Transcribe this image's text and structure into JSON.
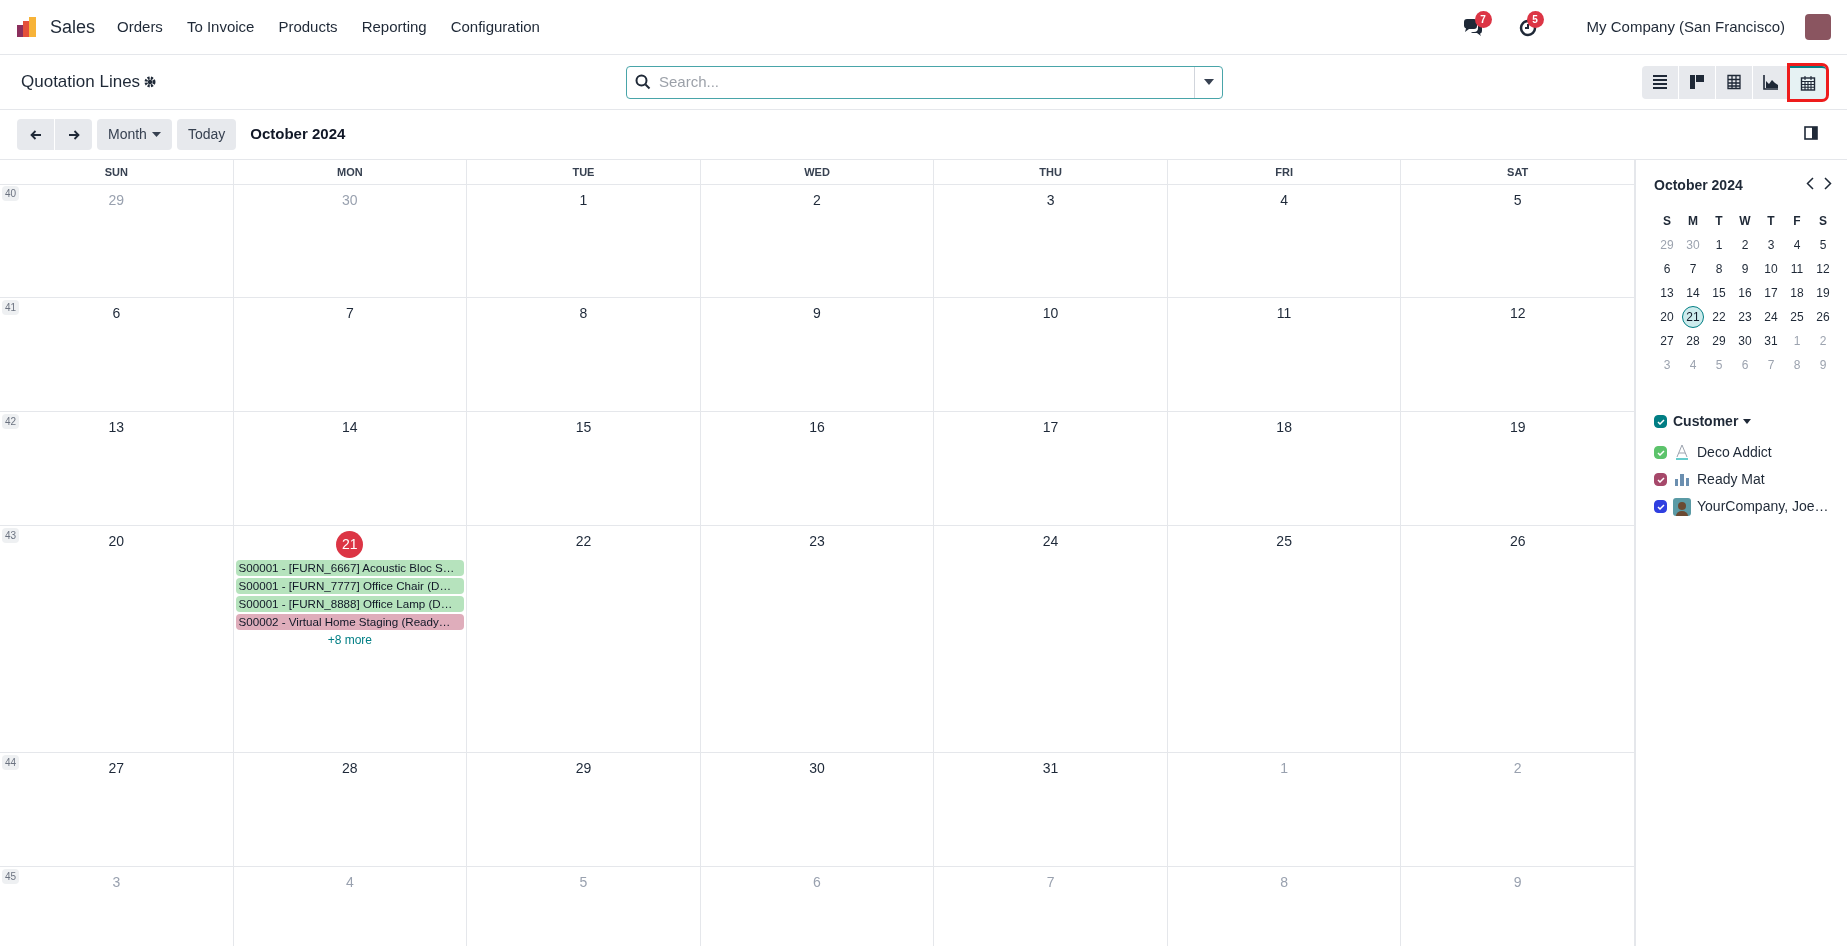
{
  "navbar": {
    "app": "Sales",
    "menus": [
      "Orders",
      "To Invoice",
      "Products",
      "Reporting",
      "Configuration"
    ],
    "messages_count": "7",
    "activities_count": "5",
    "company": "My Company (San Francisco)"
  },
  "control_panel": {
    "title": "Quotation Lines",
    "search": {
      "placeholder": "Search..."
    },
    "views": [
      {
        "kind": "list",
        "selected": false
      },
      {
        "kind": "kanban",
        "selected": false
      },
      {
        "kind": "pivot",
        "selected": false
      },
      {
        "kind": "graph",
        "selected": false
      },
      {
        "kind": "calendar",
        "selected": true
      }
    ]
  },
  "toolbar": {
    "scale": "Month",
    "today": "Today",
    "period": "October 2024"
  },
  "calendar": {
    "weekdays": [
      "SUN",
      "MON",
      "TUE",
      "WED",
      "THU",
      "FRI",
      "SAT"
    ],
    "weeks": [
      {
        "number": "40",
        "days": [
          {
            "label": "29",
            "muted": true
          },
          {
            "label": "30",
            "muted": true
          },
          {
            "label": "1",
            "muted": false
          },
          {
            "label": "2",
            "muted": false
          },
          {
            "label": "3",
            "muted": false
          },
          {
            "label": "4",
            "muted": false
          },
          {
            "label": "5",
            "muted": false
          }
        ]
      },
      {
        "number": "41",
        "days": [
          {
            "label": "6",
            "muted": false
          },
          {
            "label": "7",
            "muted": false
          },
          {
            "label": "8",
            "muted": false
          },
          {
            "label": "9",
            "muted": false
          },
          {
            "label": "10",
            "muted": false
          },
          {
            "label": "11",
            "muted": false
          },
          {
            "label": "12",
            "muted": false
          }
        ]
      },
      {
        "number": "42",
        "days": [
          {
            "label": "13",
            "muted": false
          },
          {
            "label": "14",
            "muted": false
          },
          {
            "label": "15",
            "muted": false
          },
          {
            "label": "16",
            "muted": false
          },
          {
            "label": "17",
            "muted": false
          },
          {
            "label": "18",
            "muted": false
          },
          {
            "label": "19",
            "muted": false
          }
        ]
      },
      {
        "number": "43",
        "days": [
          {
            "label": "20",
            "muted": false
          },
          {
            "label": "21",
            "muted": false,
            "today": true,
            "events": [
              {
                "title": "S00001 - [FURN_6667] Acoustic Bloc S…",
                "color": "#b6e3bd"
              },
              {
                "title": "S00001 - [FURN_7777] Office Chair (D…",
                "color": "#b6e3bd"
              },
              {
                "title": "S00001 - [FURN_8888] Office Lamp (D…",
                "color": "#b6e3bd"
              },
              {
                "title": "S00002 - Virtual Home Staging (Ready…",
                "color": "#dfadbb"
              }
            ],
            "more": "+8 more"
          },
          {
            "label": "22",
            "muted": false
          },
          {
            "label": "23",
            "muted": false
          },
          {
            "label": "24",
            "muted": false
          },
          {
            "label": "25",
            "muted": false
          },
          {
            "label": "26",
            "muted": false
          }
        ]
      },
      {
        "number": "44",
        "days": [
          {
            "label": "27",
            "muted": false
          },
          {
            "label": "28",
            "muted": false
          },
          {
            "label": "29",
            "muted": false
          },
          {
            "label": "30",
            "muted": false
          },
          {
            "label": "31",
            "muted": false
          },
          {
            "label": "1",
            "muted": true
          },
          {
            "label": "2",
            "muted": true
          }
        ]
      },
      {
        "number": "45",
        "days": [
          {
            "label": "3",
            "muted": true
          },
          {
            "label": "4",
            "muted": true
          },
          {
            "label": "5",
            "muted": true
          },
          {
            "label": "6",
            "muted": true
          },
          {
            "label": "7",
            "muted": true
          },
          {
            "label": "8",
            "muted": true
          },
          {
            "label": "9",
            "muted": true
          }
        ]
      }
    ]
  },
  "sidebar": {
    "mini_calendar": {
      "title": "October 2024",
      "weekdays": [
        "S",
        "M",
        "T",
        "W",
        "T",
        "F",
        "S"
      ],
      "days": [
        {
          "label": "29",
          "muted": true,
          "selected": false
        },
        {
          "label": "30",
          "muted": true,
          "selected": false
        },
        {
          "label": "1",
          "muted": false,
          "selected": false
        },
        {
          "label": "2",
          "muted": false,
          "selected": false
        },
        {
          "label": "3",
          "muted": false,
          "selected": false
        },
        {
          "label": "4",
          "muted": false,
          "selected": false
        },
        {
          "label": "5",
          "muted": false,
          "selected": false
        },
        {
          "label": "6",
          "muted": false,
          "selected": false
        },
        {
          "label": "7",
          "muted": false,
          "selected": false
        },
        {
          "label": "8",
          "muted": false,
          "selected": false
        },
        {
          "label": "9",
          "muted": false,
          "selected": false
        },
        {
          "label": "10",
          "muted": false,
          "selected": false
        },
        {
          "label": "11",
          "muted": false,
          "selected": false
        },
        {
          "label": "12",
          "muted": false,
          "selected": false
        },
        {
          "label": "13",
          "muted": false,
          "selected": false
        },
        {
          "label": "14",
          "muted": false,
          "selected": false
        },
        {
          "label": "15",
          "muted": false,
          "selected": false
        },
        {
          "label": "16",
          "muted": false,
          "selected": false
        },
        {
          "label": "17",
          "muted": false,
          "selected": false
        },
        {
          "label": "18",
          "muted": false,
          "selected": false
        },
        {
          "label": "19",
          "muted": false,
          "selected": false
        },
        {
          "label": "20",
          "muted": false,
          "selected": false
        },
        {
          "label": "21",
          "muted": false,
          "selected": true
        },
        {
          "label": "22",
          "muted": false,
          "selected": false
        },
        {
          "label": "23",
          "muted": false,
          "selected": false
        },
        {
          "label": "24",
          "muted": false,
          "selected": false
        },
        {
          "label": "25",
          "muted": false,
          "selected": false
        },
        {
          "label": "26",
          "muted": false,
          "selected": false
        },
        {
          "label": "27",
          "muted": false,
          "selected": false
        },
        {
          "label": "28",
          "muted": false,
          "selected": false
        },
        {
          "label": "29",
          "muted": false,
          "selected": false
        },
        {
          "label": "30",
          "muted": false,
          "selected": false
        },
        {
          "label": "31",
          "muted": false,
          "selected": false
        },
        {
          "label": "1",
          "muted": true,
          "selected": false
        },
        {
          "label": "2",
          "muted": true,
          "selected": false
        },
        {
          "label": "3",
          "muted": true,
          "selected": false
        },
        {
          "label": "4",
          "muted": true,
          "selected": false
        },
        {
          "label": "5",
          "muted": true,
          "selected": false
        },
        {
          "label": "6",
          "muted": true,
          "selected": false
        },
        {
          "label": "7",
          "muted": true,
          "selected": false
        },
        {
          "label": "8",
          "muted": true,
          "selected": false
        },
        {
          "label": "9",
          "muted": true,
          "selected": false
        }
      ]
    },
    "filter": {
      "title": "Customer",
      "checked": true,
      "color": "#017e84",
      "items": [
        {
          "name": "Deco Addict",
          "checked": true,
          "color": "#5cc36b"
        },
        {
          "name": "Ready Mat",
          "checked": true,
          "color": "#a6486a"
        },
        {
          "name": "YourCompany, Joe…",
          "checked": true,
          "color": "#2f3fe0"
        }
      ]
    }
  }
}
